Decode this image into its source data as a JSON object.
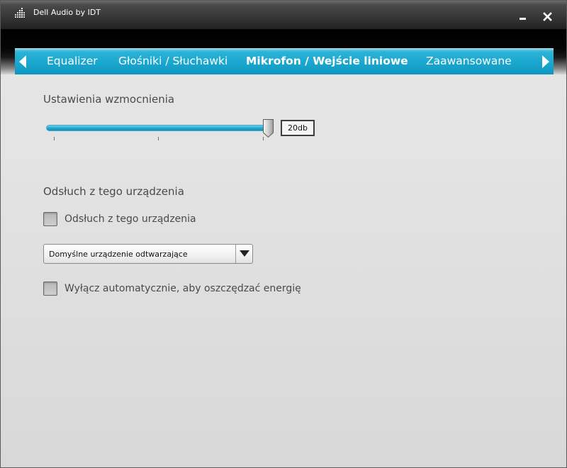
{
  "window": {
    "title": "Dell Audio by IDT",
    "icon": "equalizer-bars-icon",
    "minimize_icon": "minimize-icon",
    "close_icon": "close-icon"
  },
  "tabs": {
    "prev_icon": "chevron-left-icon",
    "next_icon": "chevron-right-icon",
    "items": [
      {
        "label": "Equalizer",
        "active": false
      },
      {
        "label": "Głośniki / Słuchawki",
        "active": false
      },
      {
        "label": "Mikrofon / Wejście liniowe",
        "active": true
      },
      {
        "label": "Zaawansowane",
        "active": false
      }
    ]
  },
  "gain": {
    "heading": "Ustawienia wzmocnienia",
    "value_label": "20db",
    "level_fraction": 1.0
  },
  "monitoring": {
    "heading": "Odsłuch z tego urządzenia",
    "checkbox_label": "Odsłuch z tego urządzenia",
    "checked": false,
    "device_select": {
      "selected": "Domyślne urządzenie odtwarzające"
    },
    "auto_off_label": "Wyłącz automatycznie, aby oszczędzać energię",
    "auto_off_checked": false
  },
  "colors": {
    "accent": "#18a7cf",
    "titlebar": "#3a3a3a",
    "text": "#4a4a4a"
  }
}
